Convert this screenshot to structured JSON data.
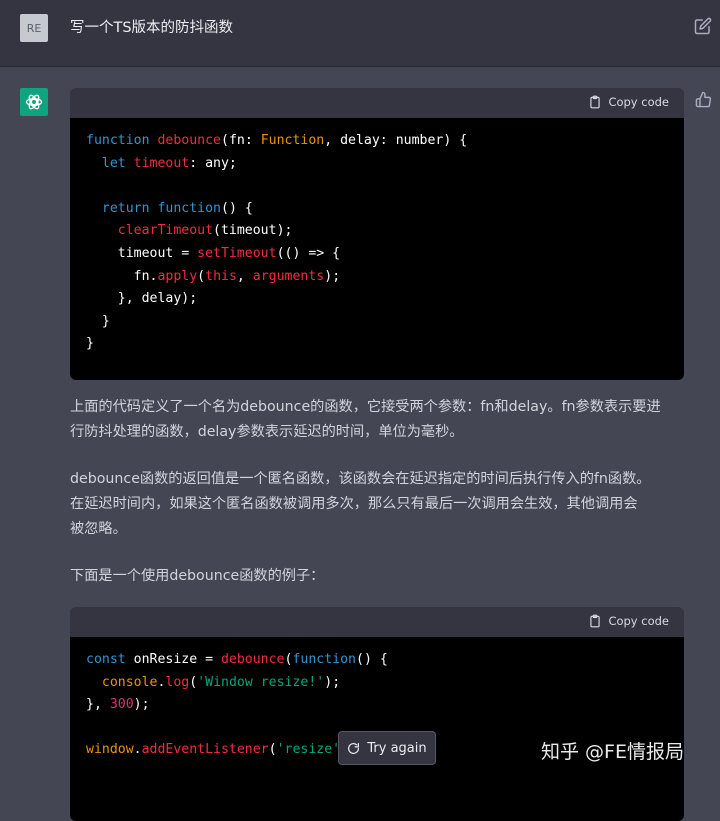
{
  "user": {
    "avatar_text": "RE",
    "message": "写一个TS版本的防抖函数"
  },
  "icons": {
    "edit": "edit-icon",
    "bot": "chatgpt-logo-icon",
    "thumb": "thumbs-up-icon",
    "copy": "clipboard-icon",
    "refresh": "refresh-icon"
  },
  "code_blocks": [
    {
      "copy_label": "Copy code",
      "lines": [
        [
          [
            "kw",
            "function "
          ],
          [
            "fn",
            "debounce"
          ],
          [
            "pl",
            "(fn: "
          ],
          [
            "ty",
            "Function"
          ],
          [
            "pl",
            ", delay: number) {"
          ]
        ],
        [
          [
            "pl",
            "  "
          ],
          [
            "kw",
            "let "
          ],
          [
            "fn",
            "timeout"
          ],
          [
            "pl",
            ": any;"
          ]
        ],
        [
          [
            "pl",
            ""
          ]
        ],
        [
          [
            "pl",
            "  "
          ],
          [
            "kw",
            "return "
          ],
          [
            "kw",
            "function"
          ],
          [
            "pl",
            "() {"
          ]
        ],
        [
          [
            "pl",
            "    "
          ],
          [
            "fn",
            "clearTimeout"
          ],
          [
            "pl",
            "(timeout);"
          ]
        ],
        [
          [
            "pl",
            "    timeout = "
          ],
          [
            "fn",
            "setTimeout"
          ],
          [
            "pl",
            "(() => {"
          ]
        ],
        [
          [
            "pl",
            "      fn."
          ],
          [
            "fn",
            "apply"
          ],
          [
            "pl",
            "("
          ],
          [
            "fn",
            "this"
          ],
          [
            "pl",
            ", "
          ],
          [
            "fn",
            "arguments"
          ],
          [
            "pl",
            ");"
          ]
        ],
        [
          [
            "pl",
            "    }, delay);"
          ]
        ],
        [
          [
            "pl",
            "  }"
          ]
        ],
        [
          [
            "pl",
            "}"
          ]
        ]
      ]
    },
    {
      "copy_label": "Copy code",
      "lines": [
        [
          [
            "kw",
            "const "
          ],
          [
            "pl",
            "onResize = "
          ],
          [
            "fn",
            "debounce"
          ],
          [
            "pl",
            "("
          ],
          [
            "kw",
            "function"
          ],
          [
            "pl",
            "() {"
          ]
        ],
        [
          [
            "pl",
            "  "
          ],
          [
            "ty",
            "console"
          ],
          [
            "pl",
            "."
          ],
          [
            "fn",
            "log"
          ],
          [
            "pl",
            "("
          ],
          [
            "st",
            "'Window resize!'"
          ],
          [
            "pl",
            ");"
          ]
        ],
        [
          [
            "pl",
            "}, "
          ],
          [
            "nu",
            "300"
          ],
          [
            "pl",
            ");"
          ]
        ],
        [
          [
            "pl",
            ""
          ]
        ],
        [
          [
            "ty",
            "window"
          ],
          [
            "pl",
            "."
          ],
          [
            "fn",
            "addEventListener"
          ],
          [
            "pl",
            "("
          ],
          [
            "st",
            "'resize'"
          ]
        ]
      ]
    }
  ],
  "paragraphs": {
    "p1": [
      "上面的代码定义了一个名为debounce的函数，它接受两个参数：fn和delay。fn参数表示要进",
      "行防抖处理的函数，delay参数表示延迟的时间，单位为毫秒。"
    ],
    "p2": [
      "debounce函数的返回值是一个匿名函数，该函数会在延迟指定的时间后执行传入的fn函数。",
      "在延迟时间内，如果这个匿名函数被调用多次，那么只有最后一次调用会生效，其他调用会",
      "被忽略。"
    ],
    "p3": [
      "下面是一个使用debounce函数的例子："
    ]
  },
  "try_again_label": "Try again",
  "watermark": "知乎 @FE情报局"
}
